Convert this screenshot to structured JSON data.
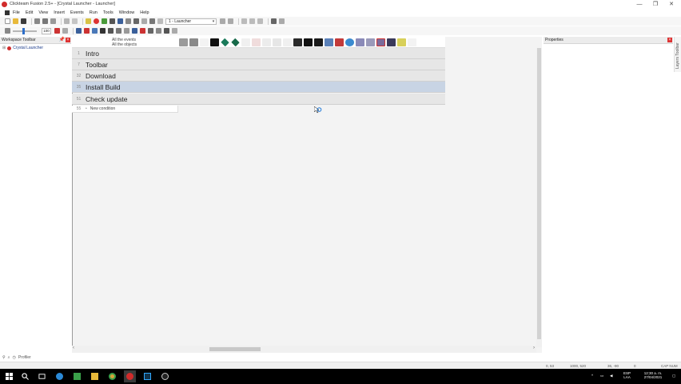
{
  "window": {
    "title": "Clickteam Fusion 2.5+ - [Crystal Launcher - Launcher]",
    "controls": [
      "—",
      "❐",
      "✕"
    ]
  },
  "menu": [
    "File",
    "Edit",
    "View",
    "Insert",
    "Events",
    "Run",
    "Tools",
    "Window",
    "Help"
  ],
  "toolbar": {
    "frame_selector": "1 - Launcher",
    "zoom_value": "100"
  },
  "workspace": {
    "title": "Workspace Toolbar",
    "pin": "📌",
    "close": "×",
    "tree_expander": "⊞",
    "tree_item": "Crystal Launcher"
  },
  "event_editor": {
    "all_events": "All the events",
    "all_objects": "All the objects",
    "groups": [
      {
        "line": "1",
        "title": "Intro",
        "selected": false
      },
      {
        "line": "7",
        "title": "Toolbar",
        "selected": false
      },
      {
        "line": "32",
        "title": "Download",
        "selected": false
      },
      {
        "line": "35",
        "title": "Install Build",
        "selected": true
      },
      {
        "line": "51",
        "title": "Check update",
        "selected": false
      }
    ],
    "new_condition": {
      "line": "55",
      "bullet": "•",
      "label": "New condition"
    }
  },
  "properties": {
    "title": "Properties",
    "close": "×",
    "side_tab": "Layers Toolbar"
  },
  "bottom_tabs": {
    "profiler": "Profiler"
  },
  "statusbar": {
    "coords": "0, 53",
    "size": "1000, 520",
    "mouse": "36, -90",
    "zero": "0",
    "keys": "CAP NUM"
  },
  "taskbar": {
    "lang_top": "ESP",
    "lang_bottom": "LAA",
    "time": "12:30 a. m.",
    "date": "27/04/2021"
  }
}
